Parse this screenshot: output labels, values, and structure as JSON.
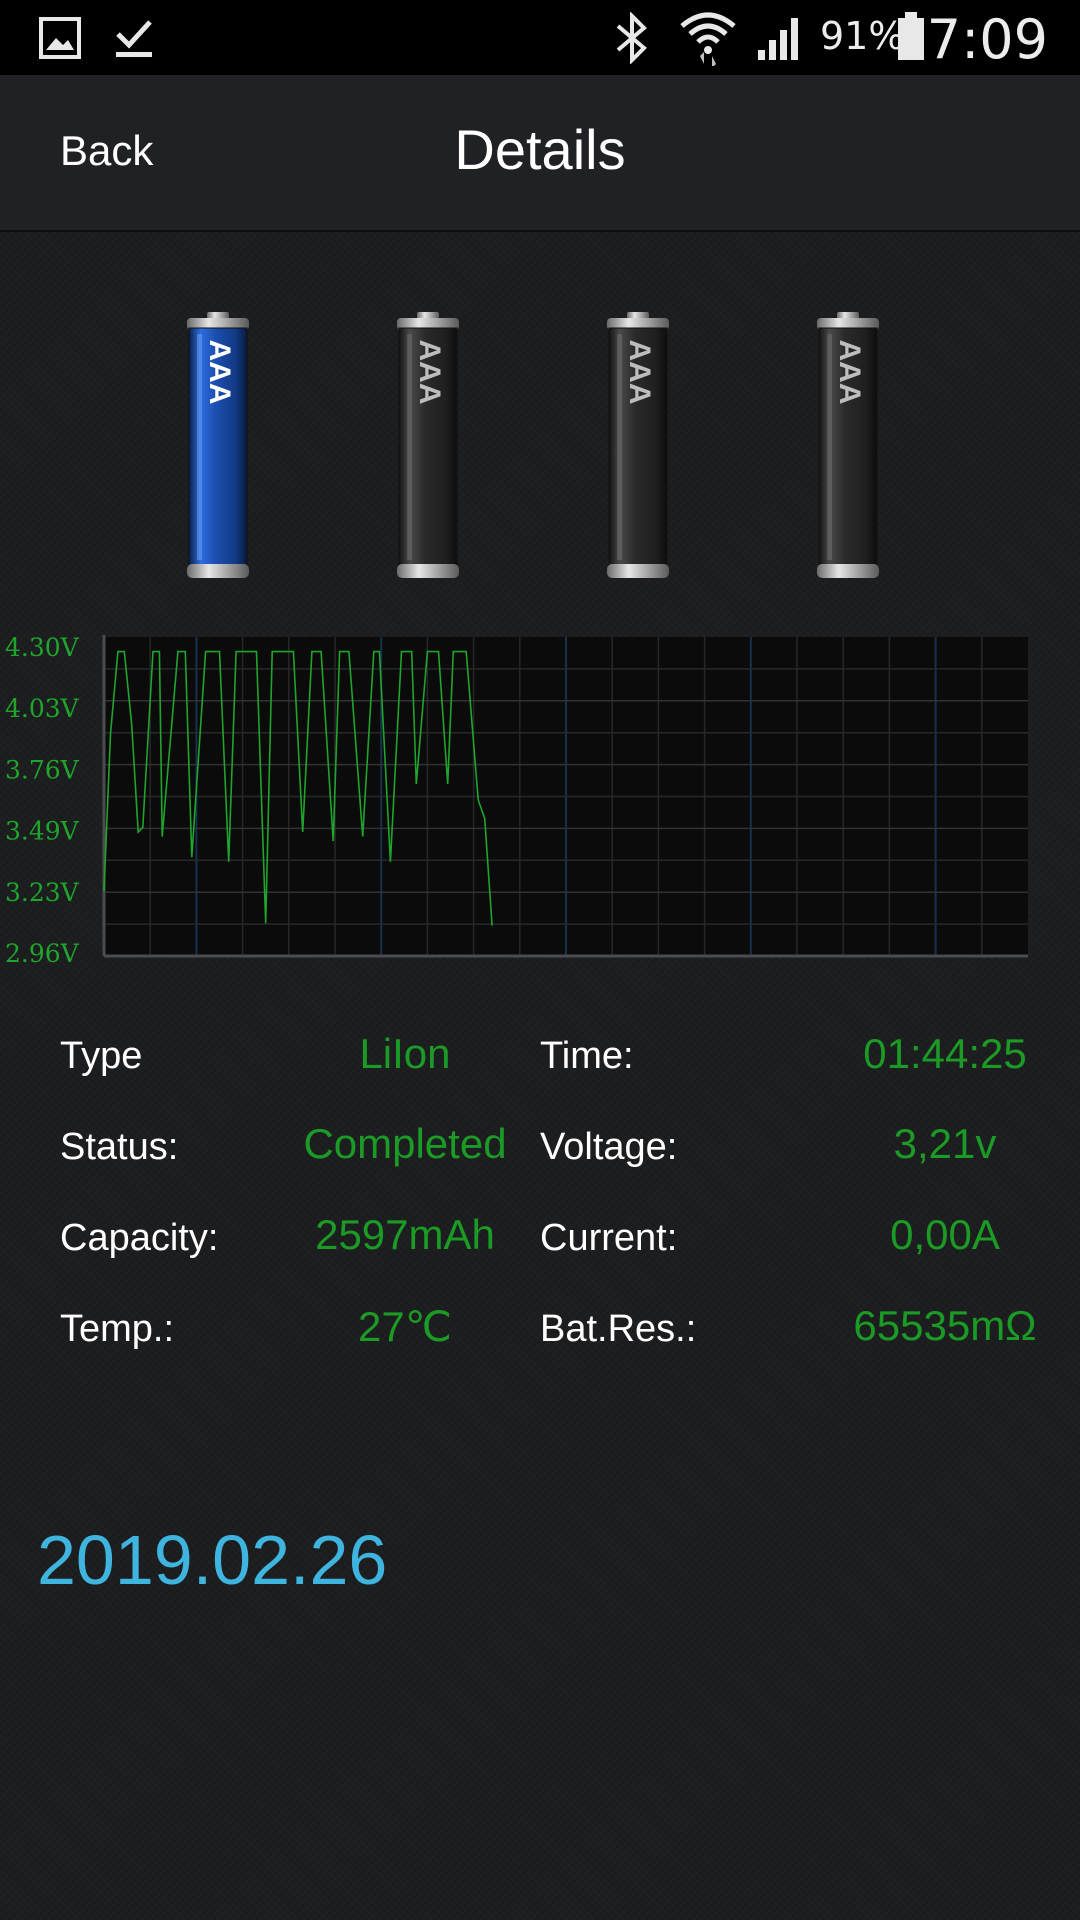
{
  "status_bar": {
    "icons": [
      "gallery-icon",
      "download-done-icon",
      "bluetooth-icon",
      "wifi-icon",
      "signal-icon",
      "battery-icon"
    ],
    "battery_percent": "91%",
    "time": "7:09"
  },
  "header": {
    "back_label": "Back",
    "title": "Details"
  },
  "slots": [
    {
      "label": "AAA",
      "selected": true
    },
    {
      "label": "AAA",
      "selected": false
    },
    {
      "label": "AAA",
      "selected": false
    },
    {
      "label": "AAA",
      "selected": false
    }
  ],
  "chart_data": {
    "type": "line",
    "y_tick_labels": [
      "4.30V",
      "4.03V",
      "3.76V",
      "3.49V",
      "3.23V",
      "2.96V"
    ],
    "ylim": [
      2.96,
      4.3
    ],
    "xlim": [
      0,
      1
    ],
    "grid": true,
    "series": [
      {
        "x": [
          0.0,
          0.007,
          0.015,
          0.022,
          0.03,
          0.037,
          0.042,
          0.053,
          0.06,
          0.063,
          0.08,
          0.088,
          0.095,
          0.11,
          0.125,
          0.135,
          0.143,
          0.165,
          0.175,
          0.182,
          0.205,
          0.215,
          0.225,
          0.235,
          0.248,
          0.255,
          0.265,
          0.28,
          0.292,
          0.298,
          0.31,
          0.322,
          0.333,
          0.338,
          0.35,
          0.362,
          0.372,
          0.378,
          0.392,
          0.405,
          0.412,
          0.42
        ],
        "y": [
          3.23,
          3.92,
          4.28,
          4.28,
          3.96,
          3.49,
          3.51,
          4.28,
          4.28,
          3.47,
          4.28,
          4.28,
          3.38,
          4.28,
          4.28,
          3.36,
          4.28,
          4.28,
          3.09,
          4.28,
          4.28,
          3.49,
          4.28,
          4.28,
          3.45,
          4.28,
          4.28,
          3.47,
          4.28,
          4.28,
          3.36,
          4.28,
          4.28,
          3.7,
          4.28,
          4.28,
          3.7,
          4.28,
          4.28,
          3.63,
          3.55,
          3.08
        ]
      }
    ],
    "colors": {
      "line": "#1fa52b",
      "tick_label": "#1fa52b",
      "plot_bg": "#0b0b0b",
      "minor_grid": "#27282a",
      "major_grid": "#17304e"
    }
  },
  "details": {
    "type": {
      "label": "Type",
      "value": "LiIon"
    },
    "status": {
      "label": "Status:",
      "value": "Completed"
    },
    "capacity": {
      "label": "Capacity:",
      "value": "2597mAh"
    },
    "temp": {
      "label": "Temp.:",
      "value": "27℃"
    },
    "time": {
      "label": "Time:",
      "value": "01:44:25"
    },
    "voltage": {
      "label": "Voltage:",
      "value": "3,21v"
    },
    "current": {
      "label": "Current:",
      "value": "0,00A"
    },
    "bat_res": {
      "label": "Bat.Res.:",
      "value": "65535mΩ"
    }
  },
  "date": "2019.02.26",
  "colors": {
    "value_green": "#1b9a25",
    "date_blue": "#3fb4df",
    "selected_battery": "#1d4fb0"
  }
}
